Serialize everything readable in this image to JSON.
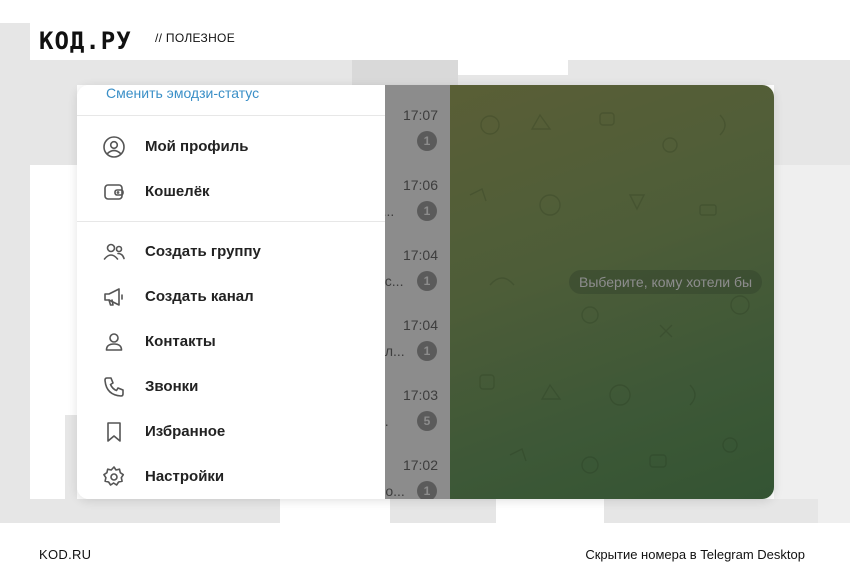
{
  "branding": {
    "logo": "КОД.РУ",
    "tagline": "// ПОЛЕЗНОЕ"
  },
  "footer": {
    "left": "KOD.RU",
    "right": "Скрытие номера в Telegram Desktop"
  },
  "menu": {
    "status_link": "Сменить эмодзи-статус",
    "items": [
      {
        "label": "Мой профиль",
        "icon": "profile-icon"
      },
      {
        "label": "Кошелёк",
        "icon": "wallet-icon"
      },
      {
        "label": "Создать группу",
        "icon": "group-icon"
      },
      {
        "label": "Создать канал",
        "icon": "megaphone-icon"
      },
      {
        "label": "Контакты",
        "icon": "contact-icon"
      },
      {
        "label": "Звонки",
        "icon": "phone-icon"
      },
      {
        "label": "Избранное",
        "icon": "bookmark-icon"
      },
      {
        "label": "Настройки",
        "icon": "gear-icon"
      }
    ]
  },
  "chats": [
    {
      "time": "17:07",
      "snippet": "",
      "unread": "1"
    },
    {
      "time": "17:06",
      "snippet": "у...",
      "unread": "1"
    },
    {
      "time": "17:04",
      "snippet": "ес...",
      "unread": "1"
    },
    {
      "time": "17:04",
      "snippet": "ил...",
      "unread": "1"
    },
    {
      "time": "17:03",
      "snippet": "...",
      "unread": "5"
    },
    {
      "time": "17:02",
      "snippet": "ло...",
      "unread": "1"
    }
  ],
  "chat_pane": {
    "hint": "Выберите, кому хотели бы"
  },
  "colors": {
    "link": "#3a8fc7",
    "badge": "#a7a7a7",
    "chat_bg_start": "#a4ad63",
    "chat_bg_end": "#5f9a5e"
  }
}
